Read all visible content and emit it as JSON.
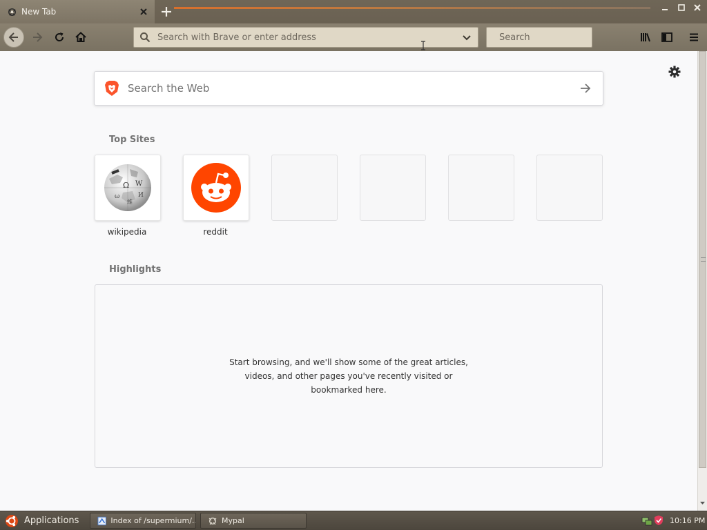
{
  "browser": {
    "tab": {
      "title": "New Tab"
    },
    "urlbar": {
      "placeholder": "Search with Brave or enter address"
    },
    "searchbar": {
      "placeholder": "Search"
    }
  },
  "newtab": {
    "search": {
      "placeholder": "Search the Web"
    },
    "top_sites_title": "Top Sites",
    "top_sites": [
      {
        "label": "wikipedia",
        "icon": "wikipedia-globe-icon"
      },
      {
        "label": "reddit",
        "icon": "reddit-alien-icon"
      },
      {
        "label": ""
      },
      {
        "label": ""
      },
      {
        "label": ""
      },
      {
        "label": ""
      }
    ],
    "highlights_title": "Highlights",
    "highlights_empty_message": "Start browsing, and we'll show some of the great articles, videos, and other pages you've recently visited or bookmarked here."
  },
  "taskbar": {
    "apps_label": "Applications",
    "tasks": [
      {
        "label": "Index of /supermium/...",
        "icon": "browser-page-icon"
      },
      {
        "label": "Mypal",
        "icon": "mypal-icon"
      }
    ],
    "clock": "10:16 PM"
  },
  "colors": {
    "accent": "#d9702c",
    "reddit": "#ff4500",
    "brave": "#fb542b",
    "chrome": "#7d7464"
  }
}
